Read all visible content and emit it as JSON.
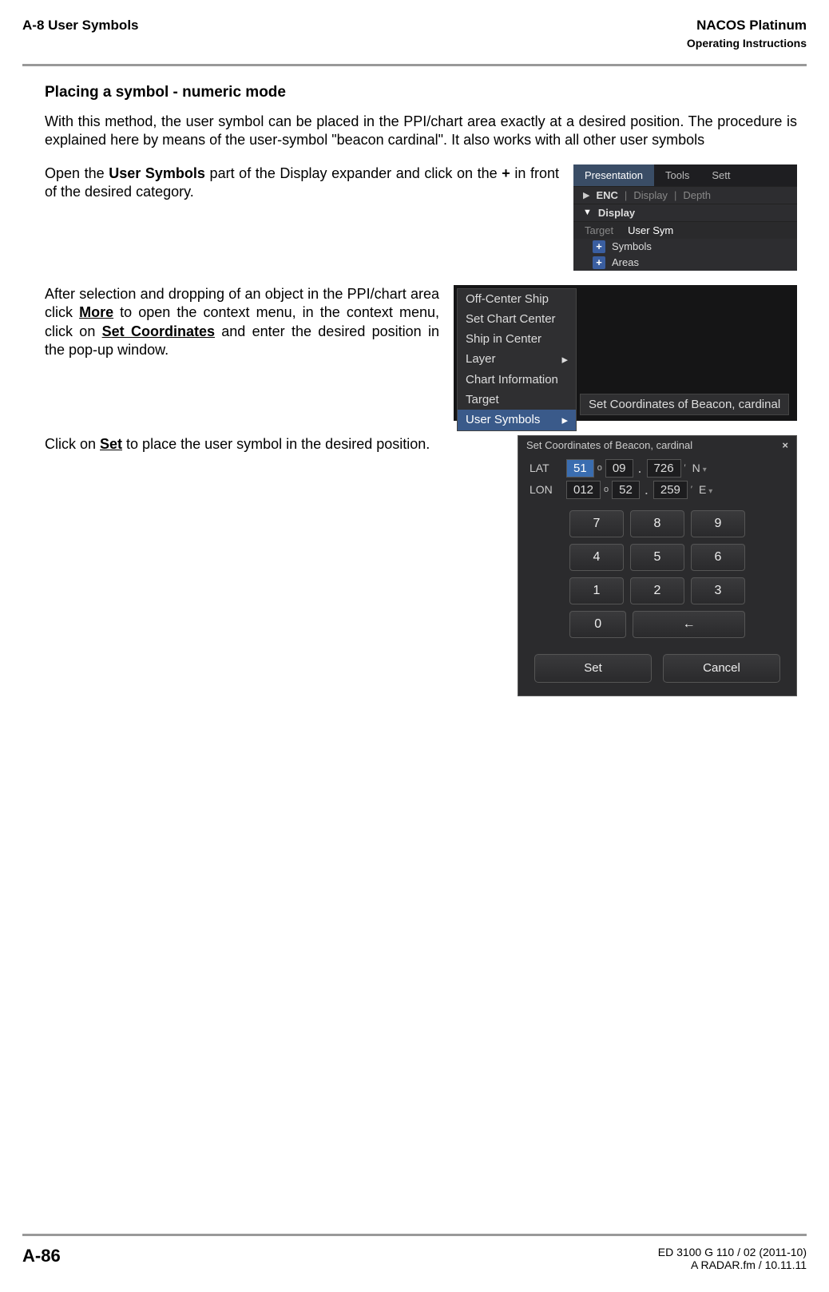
{
  "header": {
    "left": "A-8   User Symbols",
    "right1": "NACOS Platinum",
    "right2": "Operating Instructions"
  },
  "section_title": "Placing a symbol - numeric mode",
  "para1": "With this method, the user symbol can be placed in the PPI/chart area exactly at a desired position. The procedure is explained here by means of the user-symbol \"beacon cardinal\". It also works with all other user symbols",
  "para2_a": "Open the ",
  "para2_b": "User Symbols",
  "para2_c": " part of the Display expander and click on the ",
  "para2_d": "+",
  "para2_e": "  in front of the desired category.",
  "fig1": {
    "tabs": [
      "Presentation",
      "Tools",
      "Sett"
    ],
    "row_enc": "ENC",
    "row_enc_parts": [
      "Display",
      "Depth"
    ],
    "row_display": "Display",
    "row_display_parts": [
      "Target",
      "User Sym"
    ],
    "leaf1": "Symbols",
    "leaf2": "Areas"
  },
  "para3_a": "After selection and dropping of an object in the PPI/chart area click ",
  "para3_b": "More",
  "para3_c": " to open the context menu, in the context menu, click on ",
  "para3_d": "Set Coordinates",
  "para3_e": " and enter the desired position in the pop-up window.",
  "fig2": {
    "items": [
      "Off-Center Ship",
      "Set Chart Center",
      "Ship in Center",
      "Layer",
      "Chart Information",
      "Target",
      "User Symbols"
    ],
    "submenu": "Set Coordinates of Beacon, cardinal"
  },
  "para4_a": "Click on ",
  "para4_b": "Set",
  "para4_c": " to place the user symbol in the desired position.",
  "fig3": {
    "title": "Set Coordinates of  Beacon, cardinal",
    "close": "×",
    "lat": {
      "lbl": "LAT",
      "deg": "51",
      "min": "09",
      "mmin": "726",
      "hemi": "N"
    },
    "lon": {
      "lbl": "LON",
      "deg": "012",
      "min": "52",
      "mmin": "259",
      "hemi": "E"
    },
    "keys": [
      [
        "7",
        "8",
        "9"
      ],
      [
        "4",
        "5",
        "6"
      ],
      [
        "1",
        "2",
        "3"
      ]
    ],
    "zero": "0",
    "back": "←",
    "set": "Set",
    "cancel": "Cancel"
  },
  "footer": {
    "page": "A-86",
    "doc": "ED 3100 G 110 / 02 (2011-10)",
    "file": "A RADAR.fm / 10.11.11"
  }
}
